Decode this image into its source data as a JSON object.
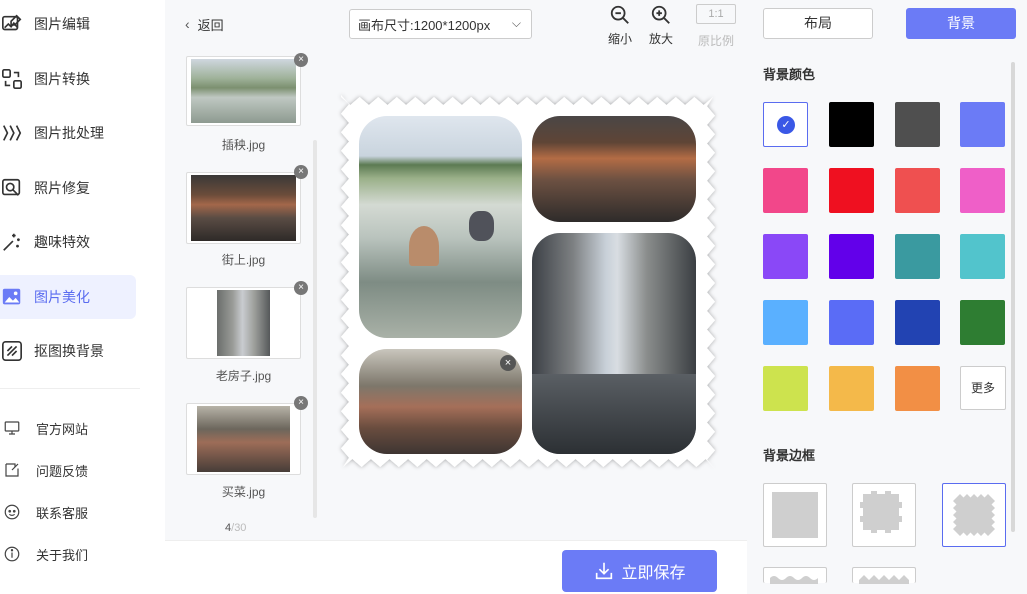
{
  "sidebar": {
    "items": [
      {
        "label": "图片编辑",
        "icon": "image-edit-icon"
      },
      {
        "label": "图片转换",
        "icon": "image-convert-icon"
      },
      {
        "label": "图片批处理",
        "icon": "batch-process-icon"
      },
      {
        "label": "照片修复",
        "icon": "photo-repair-icon"
      },
      {
        "label": "趣味特效",
        "icon": "sparkle-effects-icon"
      },
      {
        "label": "图片美化",
        "icon": "image-beautify-icon"
      },
      {
        "label": "抠图换背景",
        "icon": "cutout-background-icon"
      }
    ],
    "active_index": 5,
    "links": [
      {
        "label": "官方网站",
        "icon": "monitor-icon"
      },
      {
        "label": "问题反馈",
        "icon": "feedback-icon"
      },
      {
        "label": "联系客服",
        "icon": "support-icon"
      },
      {
        "label": "关于我们",
        "icon": "info-icon"
      }
    ]
  },
  "toolbar": {
    "back_label": "返回",
    "canvas_size": "画布尺寸:1200*1200px",
    "zoom_out": "缩小",
    "zoom_in": "放大",
    "ratio_box": "1:1",
    "ratio_label": "原比例"
  },
  "thumbnails": [
    {
      "name": "插秧.jpg"
    },
    {
      "name": "街上.jpg"
    },
    {
      "name": "老房子.jpg"
    },
    {
      "name": "买菜.jpg"
    }
  ],
  "page_count": {
    "current": "4",
    "separator": "/",
    "total": "30"
  },
  "save_label": "立即保存",
  "panel": {
    "tab_layout": "布局",
    "tab_background": "背景",
    "bg_color_title": "背景颜色",
    "bg_border_title": "背景边框",
    "more_label": "更多",
    "selected_swatch": 0,
    "swatches": [
      "#ffffff",
      "#000000",
      "#4f4f4f",
      "#6b7bf6",
      "#f2478a",
      "#ef1020",
      "#ef5050",
      "#ef5fc8",
      "#8a48f7",
      "#6200ea",
      "#3a9aa0",
      "#52c4cc",
      "#5ab0ff",
      "#5a6cf6",
      "#2243b2",
      "#2e7d32",
      "#cde34e",
      "#f4b94a",
      "#f28f45"
    ]
  },
  "colors": {
    "accent": "#6b7bf6",
    "active_bg": "#eef1ff"
  }
}
